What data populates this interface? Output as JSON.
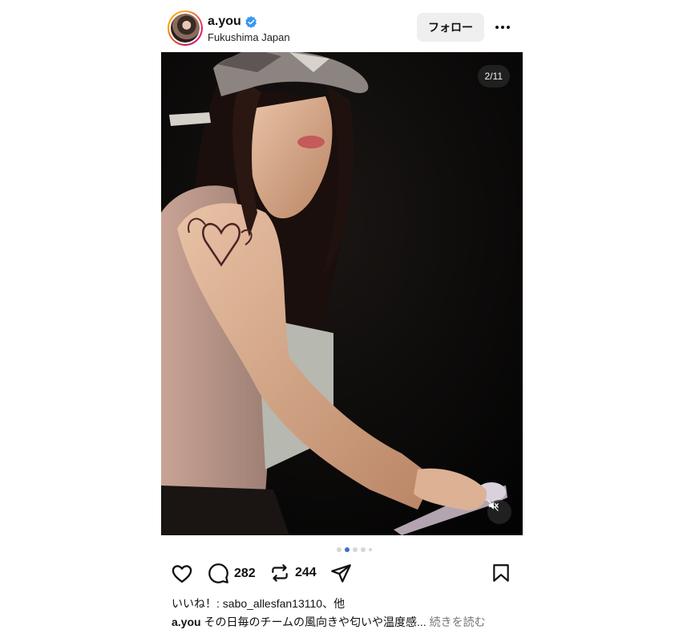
{
  "header": {
    "username": "a.you",
    "location": "Fukushima Japan",
    "follow_label": "フォロー"
  },
  "media": {
    "counter": "2/11",
    "total_slides": 11,
    "current_slide": 2,
    "muted": true
  },
  "actions": {
    "comments_count": "282",
    "reposts_count": "244"
  },
  "likes_line": "いいね！: sabo_allesfan13110、他",
  "caption": {
    "username": "a.you",
    "text": "その日毎のチームの風向きや匂いや温度感...",
    "more_label": "続きを読む"
  },
  "colors": {
    "verified": "#3897f0",
    "dot_active": "#3a6fd8",
    "follow_bg": "#efefef"
  },
  "icons": [
    "verified-badge-icon",
    "more-options-icon",
    "mute-icon",
    "heart-icon",
    "comment-icon",
    "repost-icon",
    "share-icon",
    "bookmark-icon"
  ]
}
